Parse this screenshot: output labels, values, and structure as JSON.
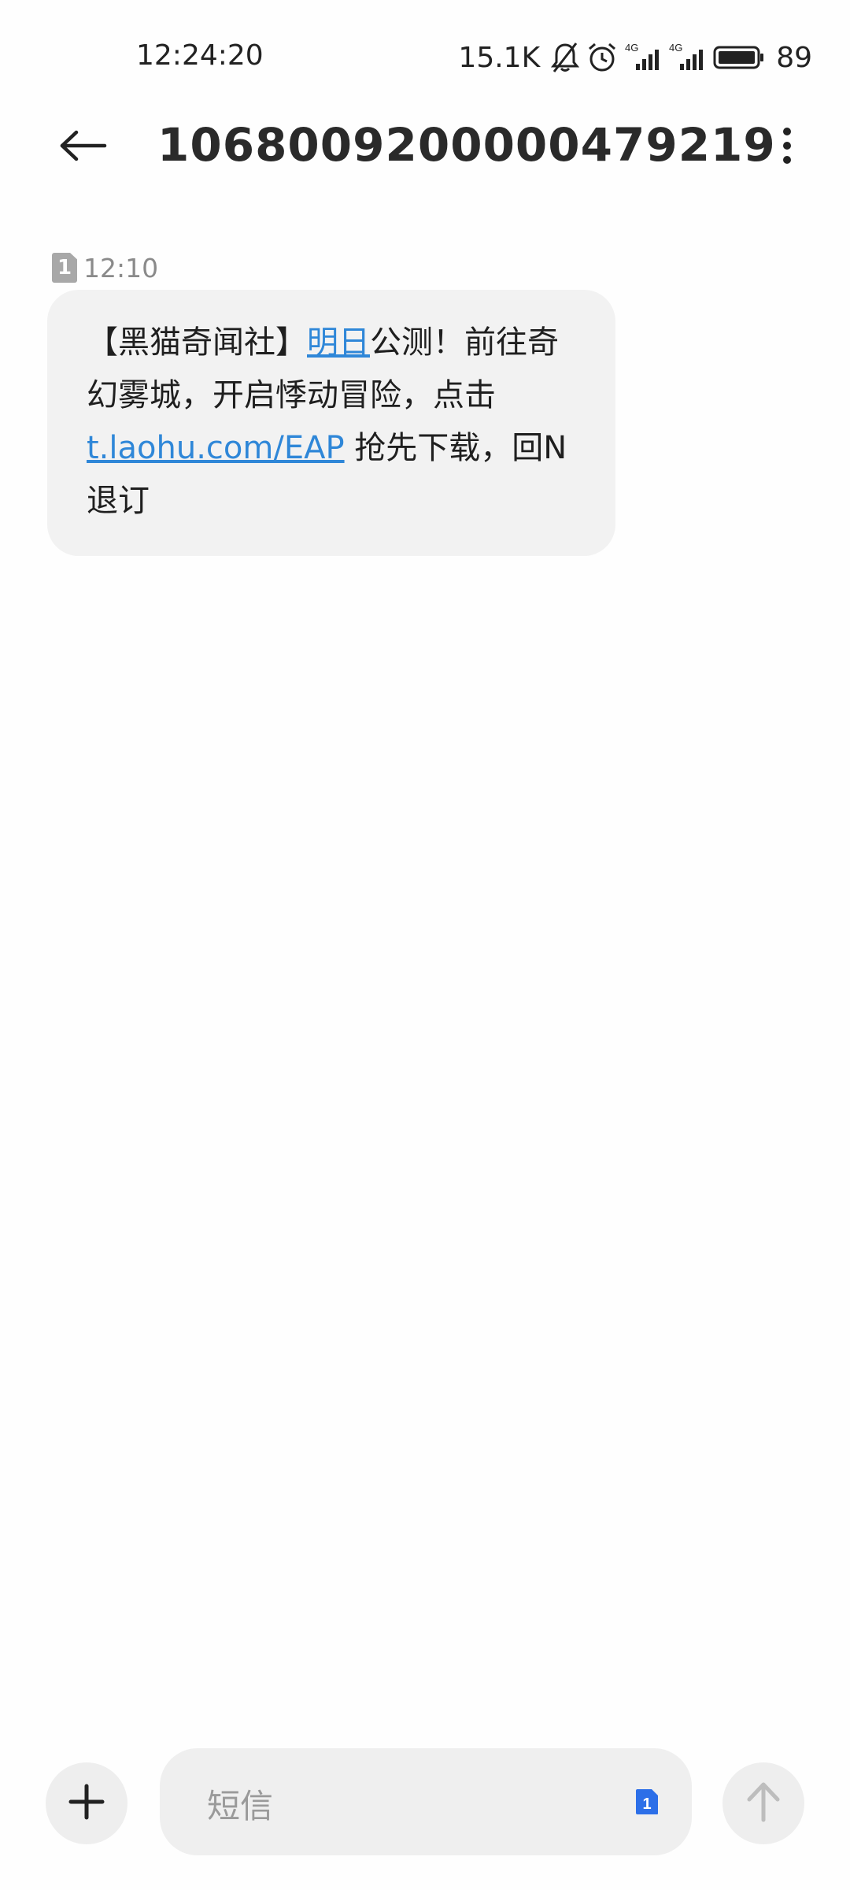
{
  "status_bar": {
    "time": "12:24:20",
    "net_speed": "15.1K",
    "battery": "89",
    "icons": [
      "bell-off-icon",
      "alarm-icon",
      "signal-4g-icon",
      "signal-4g-icon",
      "battery-icon"
    ],
    "network_label": "4G"
  },
  "header": {
    "title": "1068009200000479219",
    "back_icon": "arrow-left-icon",
    "menu_icon": "more-vertical-icon"
  },
  "message": {
    "sim": "1",
    "time": "12:10",
    "parts": {
      "p1": "【黑猫奇闻社】",
      "link1": "明日",
      "p2": "公测！前往奇幻雾城，开启悸动冒险，点击",
      "link2": "t.laohu.com/EAP",
      "p3": " 抢先下载，回N退订"
    }
  },
  "composer": {
    "placeholder": "短信",
    "sim": "1",
    "add_icon": "plus-icon",
    "send_icon": "arrow-up-icon"
  },
  "colors": {
    "link": "#2f87d8",
    "bubble_bg": "#f2f2f2",
    "sim_accent": "#2c6fe8"
  }
}
